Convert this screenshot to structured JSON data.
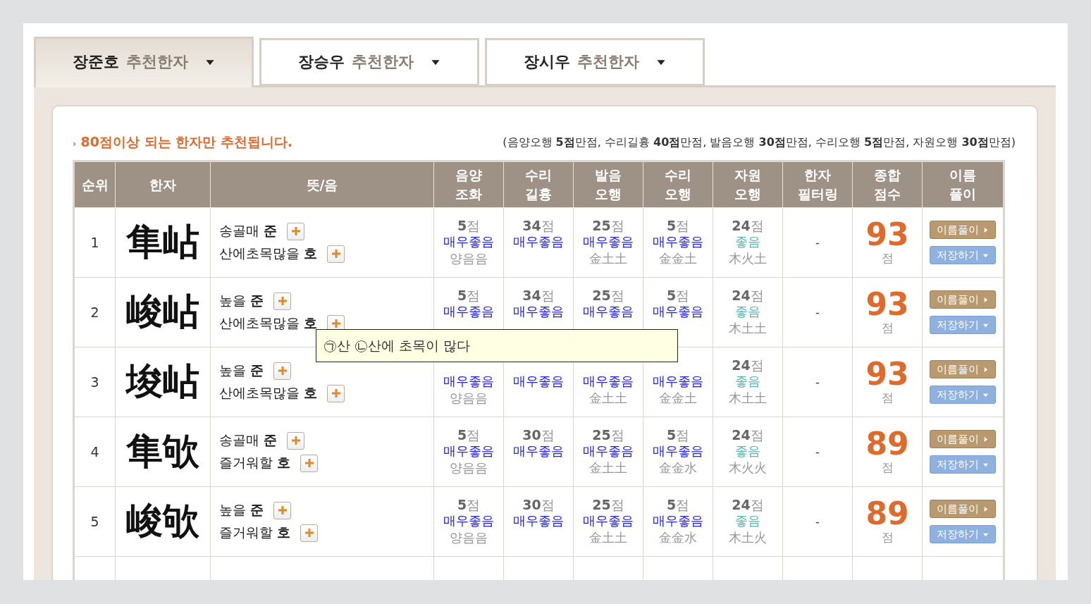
{
  "tabs": [
    {
      "name": "장준호",
      "suffix": "추천한자",
      "selected": true
    },
    {
      "name": "장승우",
      "suffix": "추천한자",
      "selected": false
    },
    {
      "name": "장시우",
      "suffix": "추천한자",
      "selected": false
    }
  ],
  "notice_mark": "›",
  "notice": "80점이상 되는 한자만 추천됩니다.",
  "criteria": "(음양오행 **5점**만점, 수리길흉 **40점**만점, 발음오행 **30점**만점, 수리오행 **5점**만점, 자원오행 **30점**만점)",
  "table": {
    "columns": [
      [
        "순위"
      ],
      [
        "한자"
      ],
      [
        "뜻/음"
      ],
      [
        "음양",
        "조화"
      ],
      [
        "수리",
        "길흉"
      ],
      [
        "발음",
        "오행"
      ],
      [
        "수리",
        "오행"
      ],
      [
        "자원",
        "오행"
      ],
      [
        "한자",
        "필터링"
      ],
      [
        "종합",
        "점수"
      ],
      [
        "이름",
        "풀이"
      ]
    ],
    "rows": [
      {
        "rank": "1",
        "hanja": "隼岾",
        "meanings": [
          {
            "meaning": "송골매",
            "reading": "준"
          },
          {
            "meaning": "산에초목많을",
            "reading": "호"
          }
        ],
        "scores": [
          {
            "score": "**5**점",
            "grade": "매우좋음",
            "color": "#2222ee",
            "detail": "양음음"
          },
          {
            "score": "**34**점",
            "grade": "매우좋음",
            "color": "#2222ee"
          },
          {
            "score": "**25**점",
            "grade": "매우좋음",
            "color": "#2222ee",
            "detail": "金土土"
          },
          {
            "score": "**5**점",
            "grade": "매우좋음",
            "color": "#2222ee",
            "detail": "金金土"
          },
          {
            "score": "**24**점",
            "grade": "좋음",
            "color": "#5ab4b4",
            "detail": "木火土"
          }
        ],
        "filter": "-",
        "total": "93",
        "total_unit": "점",
        "explain": "이름풀이",
        "save": "저장하기"
      },
      {
        "rank": "2",
        "hanja": "峻岾",
        "meanings": [
          {
            "meaning": "높을",
            "reading": "준"
          },
          {
            "meaning": "산에초목많을",
            "reading": "호"
          }
        ],
        "scores": [
          {
            "score": "**5**점",
            "grade": "매우좋음",
            "color": "#2222ee"
          },
          {
            "score": "**34**점",
            "grade": "매우좋음",
            "color": "#2222ee"
          },
          {
            "score": "**25**점",
            "grade": "매우좋음",
            "color": "#2222ee"
          },
          {
            "score": "**5**점",
            "grade": "매우좋음",
            "color": "#2222ee"
          },
          {
            "score": "**24**점",
            "grade": "좋음",
            "color": "#5ab4b4",
            "detail": "木土土"
          }
        ],
        "filter": "-",
        "total": "93",
        "total_unit": "점",
        "explain": "이름풀이",
        "save": "저장하기"
      },
      {
        "rank": "3",
        "hanja": "埈岾",
        "meanings": [
          {
            "meaning": "높을",
            "reading": "준"
          },
          {
            "meaning": "산에초목많을",
            "reading": "호"
          }
        ],
        "scores": [
          {
            "grade": "매우좋음",
            "color": "#2222ee",
            "detail": "양음음"
          },
          {
            "grade": "매우좋음",
            "color": "#2222ee"
          },
          {
            "grade": "매우좋음",
            "color": "#2222ee",
            "detail": "金土土"
          },
          {
            "grade": "매우좋음",
            "color": "#2222ee",
            "detail": "金金土"
          },
          {
            "score": "**24**점",
            "grade": "좋음",
            "color": "#5ab4b4",
            "detail": "木土土"
          }
        ],
        "filter": "-",
        "total": "93",
        "total_unit": "점",
        "explain": "이름풀이",
        "save": "저장하기"
      },
      {
        "rank": "4",
        "hanja": "隼欨",
        "meanings": [
          {
            "meaning": "송골매",
            "reading": "준"
          },
          {
            "meaning": "즐거워할",
            "reading": "호"
          }
        ],
        "scores": [
          {
            "score": "**5**점",
            "grade": "매우좋음",
            "color": "#2222ee",
            "detail": "양음음"
          },
          {
            "score": "**30**점",
            "grade": "매우좋음",
            "color": "#2222ee"
          },
          {
            "score": "**25**점",
            "grade": "매우좋음",
            "color": "#2222ee",
            "detail": "金土土"
          },
          {
            "score": "**5**점",
            "grade": "매우좋음",
            "color": "#2222ee",
            "detail": "金金水"
          },
          {
            "score": "**24**점",
            "grade": "좋음",
            "color": "#5ab4b4",
            "detail": "木火火"
          }
        ],
        "filter": "-",
        "total": "89",
        "total_unit": "점",
        "explain": "이름풀이",
        "save": "저장하기"
      },
      {
        "rank": "5",
        "hanja": "峻欨",
        "meanings": [
          {
            "meaning": "높을",
            "reading": "준"
          },
          {
            "meaning": "즐거워할",
            "reading": "호"
          }
        ],
        "scores": [
          {
            "score": "**5**점",
            "grade": "매우좋음",
            "color": "#2222ee",
            "detail": "양음음"
          },
          {
            "score": "**30**점",
            "grade": "매우좋음",
            "color": "#2222ee"
          },
          {
            "score": "**25**점",
            "grade": "매우좋음",
            "color": "#2222ee",
            "detail": "金土土"
          },
          {
            "score": "**5**점",
            "grade": "매우좋음",
            "color": "#2222ee",
            "detail": "金金水"
          },
          {
            "score": "**24**점",
            "grade": "좋음",
            "color": "#5ab4b4",
            "detail": "木土火"
          }
        ],
        "filter": "-",
        "total": "89",
        "total_unit": "점",
        "explain": "이름풀이",
        "save": "저장하기"
      }
    ]
  },
  "tooltip": "㉠산 ㉡산에 초목이 많다"
}
